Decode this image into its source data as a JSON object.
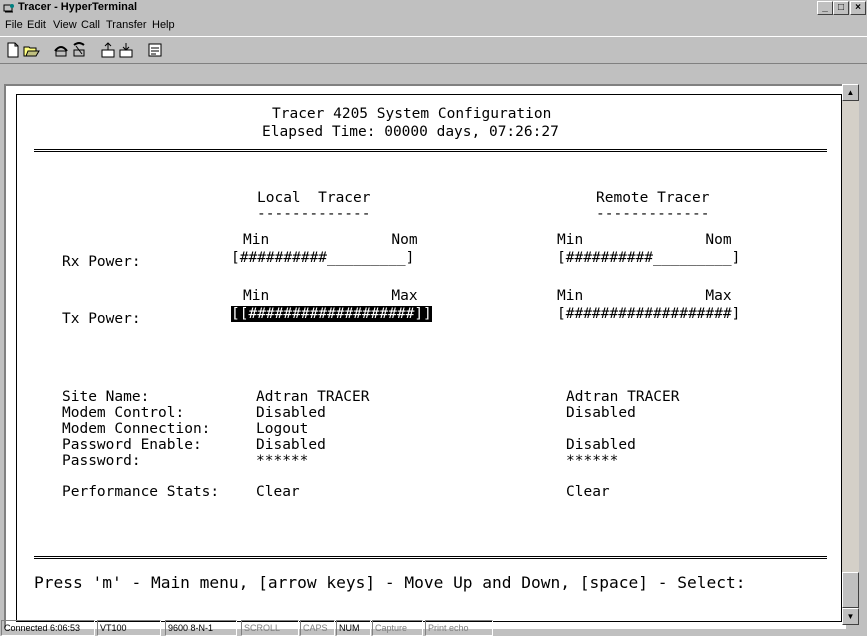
{
  "window": {
    "title": "Tracer - HyperTerminal",
    "controls": [
      "_",
      "□",
      "×"
    ]
  },
  "menu": [
    {
      "label": "File"
    },
    {
      "label": "Edit"
    },
    {
      "label": "View"
    },
    {
      "label": "Call"
    },
    {
      "label": "Transfer"
    },
    {
      "label": "Help"
    }
  ],
  "toolbar": [
    "new-icon",
    "open-icon",
    "call-icon",
    "disconnect-icon",
    "send-icon",
    "receive-icon",
    "properties-icon"
  ],
  "terminal": {
    "header_title": "Tracer 4205 System Configuration",
    "elapsed": "Elapsed Time: 00000 days, 07:26:27",
    "local_heading": "Local  Tracer",
    "remote_heading": "Remote Tracer",
    "underline": "-------------",
    "rx_label": "Rx Power:",
    "rx_scale_local": "Min              Nom",
    "rx_scale_remote": "Min              Nom",
    "rx_bar_local": "[##########_________]",
    "rx_bar_remote": "[##########_________]",
    "tx_label": "Tx Power:",
    "tx_scale_local": "Min              Max",
    "tx_scale_remote": "Min              Max",
    "tx_bar_local": "[[###################]]",
    "tx_bar_remote": "[###################]",
    "fields": {
      "site_name_label": "Site Name:",
      "site_name_local": "Adtran TRACER",
      "site_name_remote": "Adtran TRACER",
      "modem_control_label": "Modem Control:",
      "modem_control_local": "Disabled",
      "modem_control_remote": "Disabled",
      "modem_connection_label": "Modem Connection:",
      "modem_connection_local": "Logout",
      "password_enable_label": "Password Enable:",
      "password_enable_local": "Disabled",
      "password_enable_remote": "Disabled",
      "password_label": "Password:",
      "password_local": "******",
      "password_remote": "******",
      "perf_label": "Performance Stats:",
      "perf_local": "Clear",
      "perf_remote": "Clear"
    },
    "footer": "Press 'm' - Main menu, [arrow keys] - Move Up and Down, [space] - Select:"
  },
  "status": {
    "connected": "Connected 6:06:53",
    "emulation": "VT100",
    "port": "9600 8-N-1",
    "scroll": "SCROLL",
    "caps": "CAPS",
    "num": "NUM",
    "capture": "Capture",
    "print_echo": "Print echo"
  }
}
